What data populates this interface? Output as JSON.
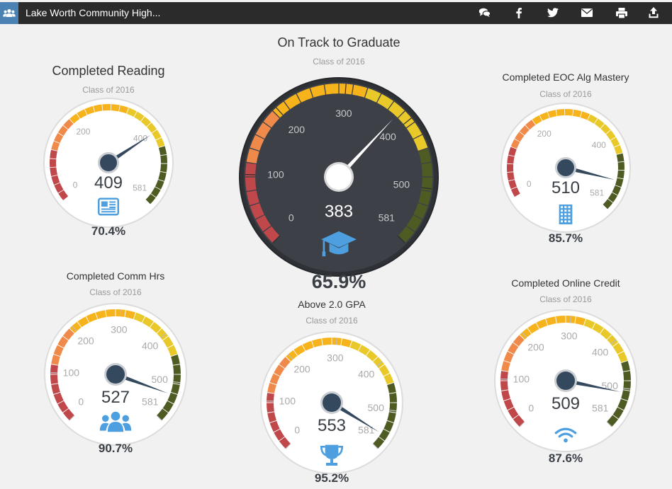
{
  "header": {
    "title": "Lake Worth Community High...",
    "app_icon": "users-icon",
    "actions": [
      {
        "name": "comments-button",
        "icon": "comments-icon"
      },
      {
        "name": "facebook-button",
        "icon": "facebook-icon"
      },
      {
        "name": "twitter-button",
        "icon": "twitter-icon"
      },
      {
        "name": "email-button",
        "icon": "envelope-icon"
      },
      {
        "name": "print-button",
        "icon": "print-icon"
      },
      {
        "name": "share-button",
        "icon": "upload-icon"
      }
    ]
  },
  "colors": {
    "red": "#c0474a",
    "orange": "#ef8a4a",
    "amber": "#f6b31c",
    "yellow": "#e9c92a",
    "green": "#4e5c24",
    "needle": "#34495e",
    "icon_blue": "#4d9fe0"
  },
  "gauges": [
    {
      "id": "reading",
      "title": "Completed Reading",
      "subtitle": "Class of 2016",
      "value": 409,
      "value_label": "409",
      "min": 0,
      "max": 581,
      "min_label": "0",
      "max_label": "581",
      "tick_labels": [
        {
          "v": 200,
          "t": "200"
        },
        {
          "v": 400,
          "t": "400"
        }
      ],
      "percent": "70.4%",
      "icon": "newspaper-icon"
    },
    {
      "id": "eoc",
      "title": "Completed EOC Alg Mastery",
      "subtitle": "Class of 2016",
      "value": 510,
      "value_label": "510",
      "min": 0,
      "max": 581,
      "min_label": "0",
      "max_label": "581",
      "tick_labels": [
        {
          "v": 200,
          "t": "200"
        },
        {
          "v": 400,
          "t": "400"
        }
      ],
      "percent": "85.7%",
      "icon": "building-icon"
    },
    {
      "id": "graduate",
      "title": "On Track to Graduate",
      "subtitle": "Class of 2016",
      "value": 383,
      "value_label": "383",
      "min": 0,
      "max": 581,
      "min_label": "0",
      "max_label": "581",
      "tick_labels": [
        {
          "v": 100,
          "t": "100"
        },
        {
          "v": 200,
          "t": "200"
        },
        {
          "v": 300,
          "t": "300"
        },
        {
          "v": 400,
          "t": "400"
        },
        {
          "v": 500,
          "t": "500"
        }
      ],
      "percent": "65.9%",
      "icon": "graduation-cap-icon"
    },
    {
      "id": "commhrs",
      "title": "Completed Comm Hrs",
      "subtitle": "Class of 2016",
      "value": 527,
      "value_label": "527",
      "min": 0,
      "max": 581,
      "min_label": "0",
      "max_label": "581",
      "tick_labels": [
        {
          "v": 100,
          "t": "100"
        },
        {
          "v": 200,
          "t": "200"
        },
        {
          "v": 300,
          "t": "300"
        },
        {
          "v": 400,
          "t": "400"
        },
        {
          "v": 500,
          "t": "500"
        }
      ],
      "percent": "90.7%",
      "icon": "users-icon"
    },
    {
      "id": "gpa",
      "title": "Above 2.0 GPA",
      "subtitle": "Class of 2016",
      "value": 553,
      "value_label": "553",
      "min": 0,
      "max": 581,
      "min_label": "0",
      "max_label": "581",
      "tick_labels": [
        {
          "v": 100,
          "t": "100"
        },
        {
          "v": 200,
          "t": "200"
        },
        {
          "v": 300,
          "t": "300"
        },
        {
          "v": 400,
          "t": "400"
        },
        {
          "v": 500,
          "t": "500"
        }
      ],
      "percent": "95.2%",
      "icon": "trophy-icon"
    },
    {
      "id": "online",
      "title": "Completed Online Credit",
      "subtitle": "Class of 2016",
      "value": 509,
      "value_label": "509",
      "min": 0,
      "max": 581,
      "min_label": "0",
      "max_label": "581",
      "tick_labels": [
        {
          "v": 100,
          "t": "100"
        },
        {
          "v": 200,
          "t": "200"
        },
        {
          "v": 300,
          "t": "300"
        },
        {
          "v": 400,
          "t": "400"
        },
        {
          "v": 500,
          "t": "500"
        }
      ],
      "percent": "87.6%",
      "icon": "wifi-icon"
    }
  ]
}
